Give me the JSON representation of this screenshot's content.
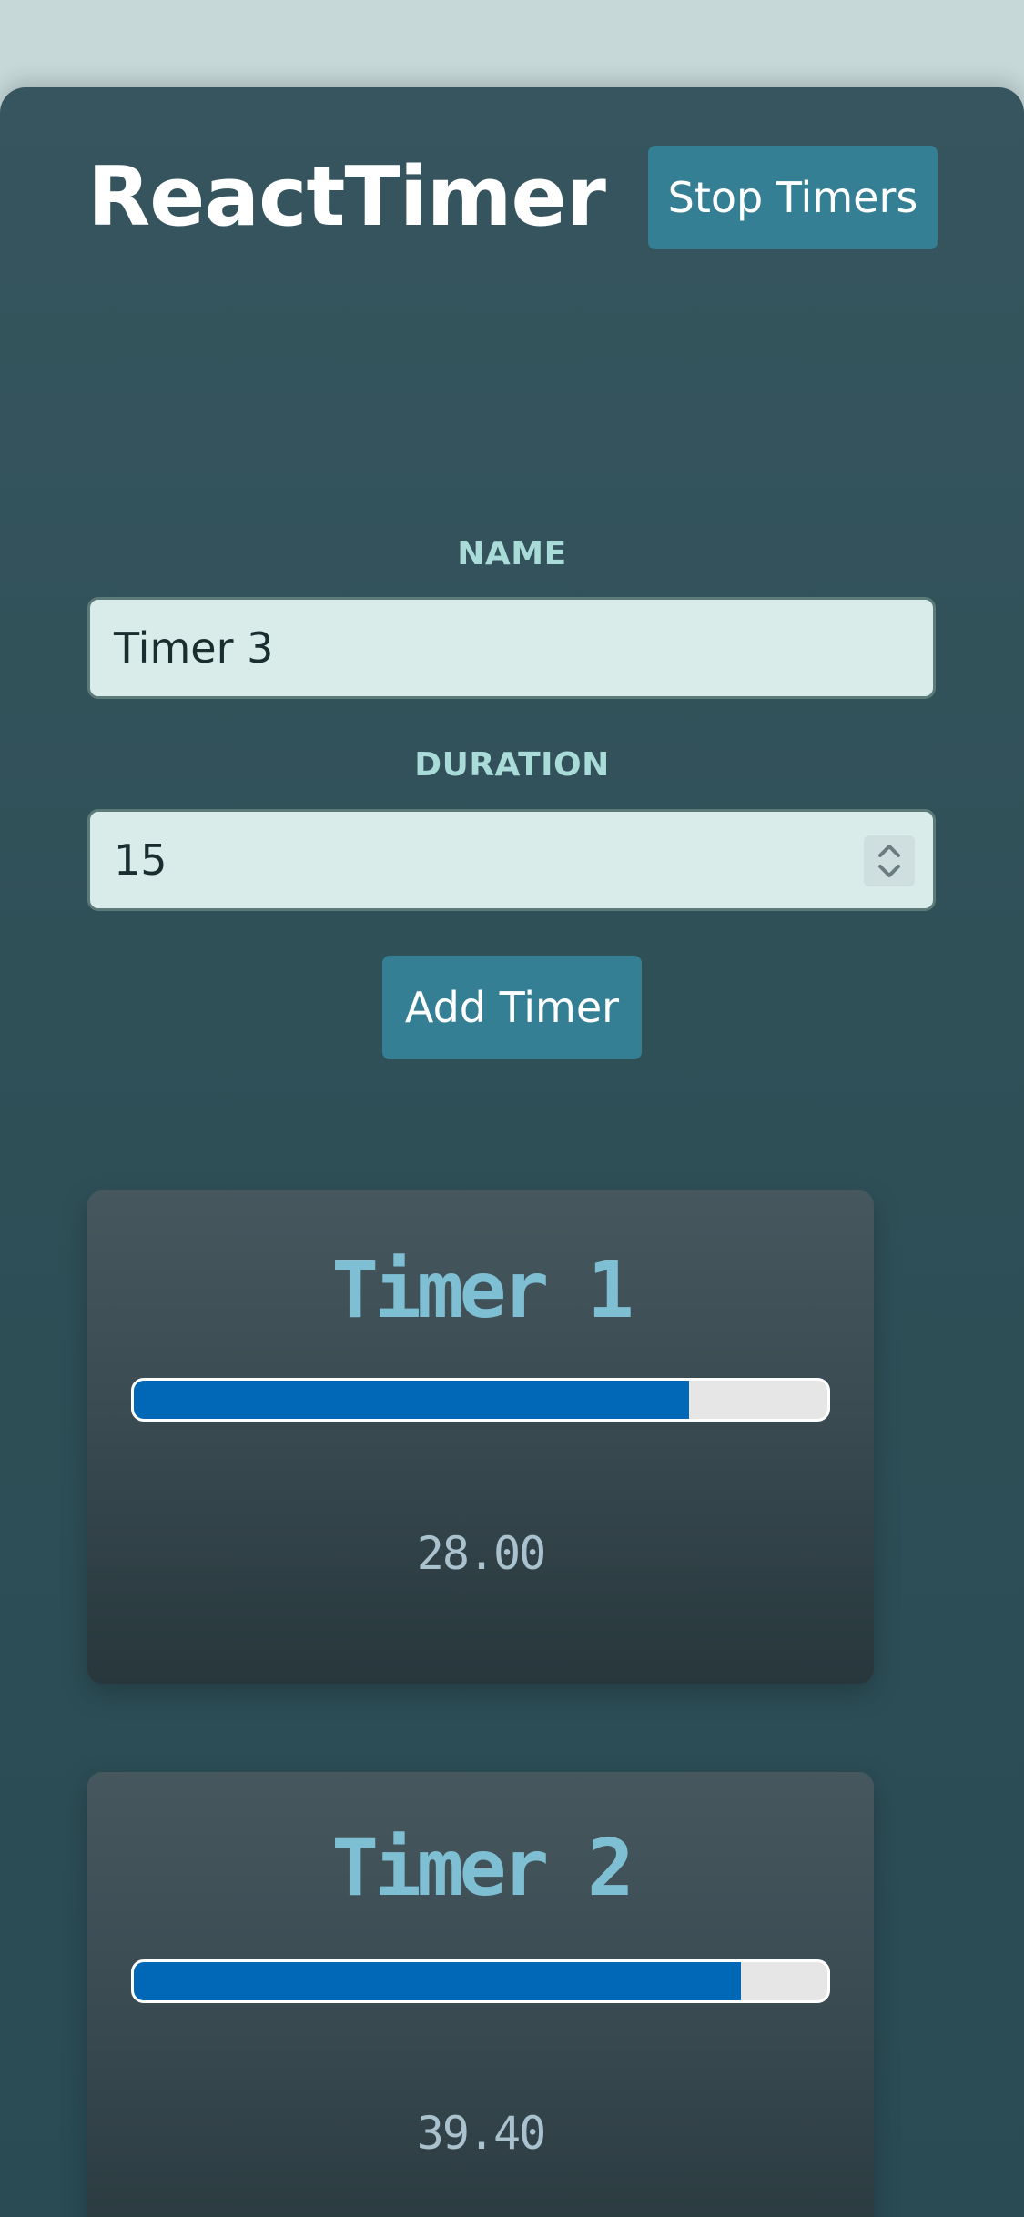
{
  "header": {
    "title": "ReactTimer",
    "stop_label": "Stop Timers"
  },
  "form": {
    "name_label": "NAME",
    "name_value": "Timer 3",
    "duration_label": "DURATION",
    "duration_value": "15",
    "add_label": "Add Timer"
  },
  "timers": [
    {
      "name": "Timer 1",
      "value": "28.00",
      "progress": 0.8
    },
    {
      "name": "Timer 2",
      "value": "39.40",
      "progress": 0.875
    }
  ],
  "colors": {
    "accent": "#347f94",
    "progress": "#0168b8",
    "label": "#a9dcd8",
    "timer_title": "#7fbfd3"
  }
}
